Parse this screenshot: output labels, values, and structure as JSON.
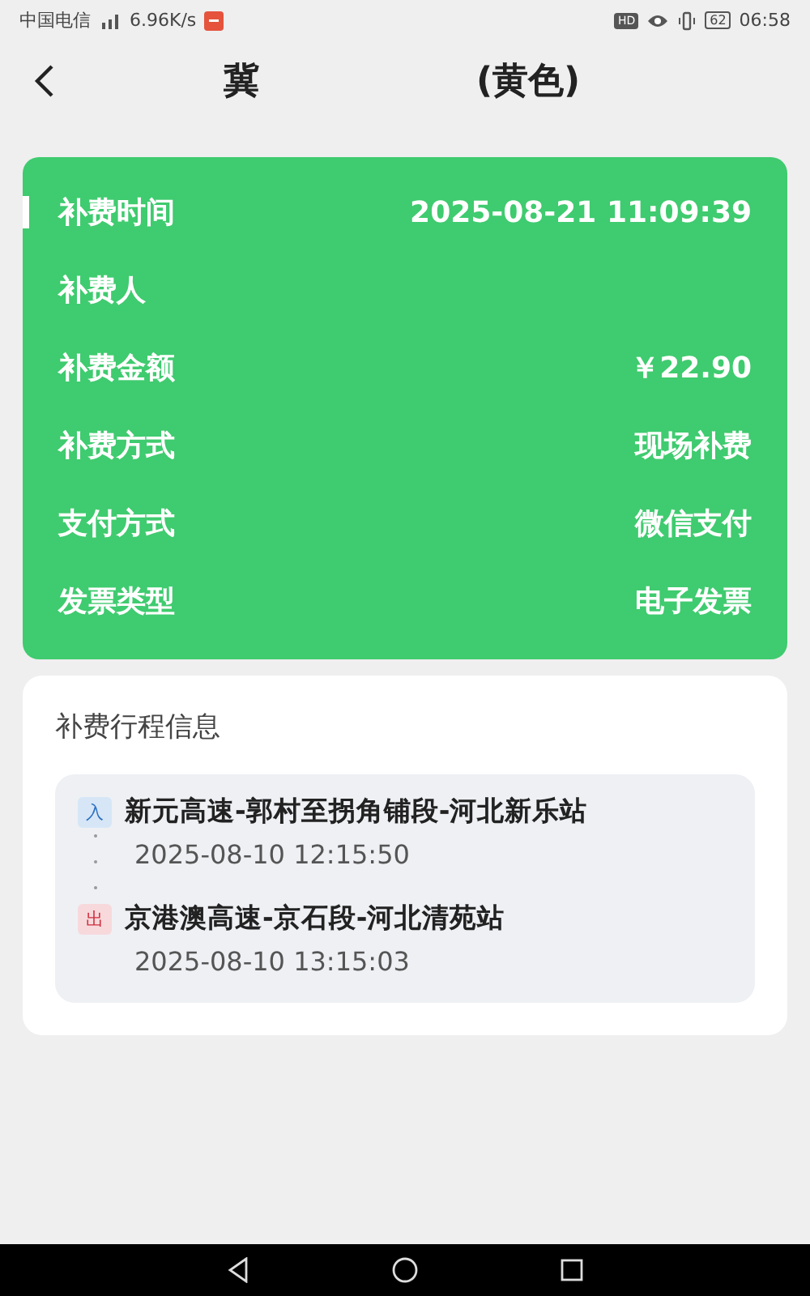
{
  "status_bar": {
    "carrier": "中国电信",
    "speed": "6.96K/s",
    "hd": "HD",
    "battery": "62",
    "time": "06:58"
  },
  "header": {
    "title_start": "冀",
    "title_end": "(黄色)"
  },
  "summary": {
    "rows": [
      {
        "label": "补费时间",
        "value": "2025-08-21 11:09:39",
        "selected": true
      },
      {
        "label": "补费人",
        "selected": false
      },
      {
        "label": "补费金额",
        "value": "￥22.90",
        "selected": false
      },
      {
        "label": "补费方式",
        "value": "现场补费",
        "selected": false
      },
      {
        "label": "支付方式",
        "value": "微信支付",
        "selected": false
      },
      {
        "label": "发票类型",
        "value": "电子发票",
        "selected": false
      }
    ]
  },
  "trip": {
    "title": "补费行程信息",
    "stops": [
      {
        "kind": "entry",
        "tag": "入",
        "station": "新元高速-郭村至拐角铺段-河北新乐站",
        "time": "2025-08-10 12:15:50"
      },
      {
        "kind": "exit",
        "tag": "出",
        "station": "京港澳高速-京石段-河北清苑站",
        "time": "2025-08-10 13:15:03"
      }
    ]
  }
}
